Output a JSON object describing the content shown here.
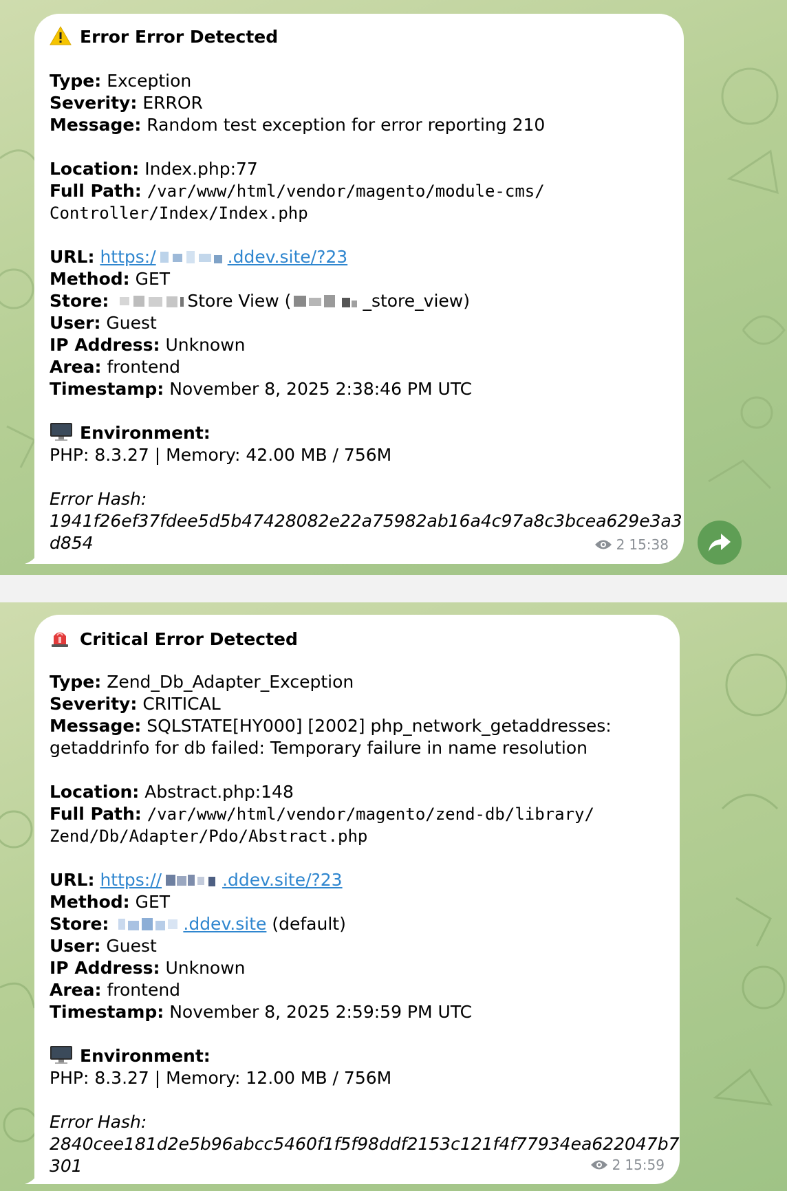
{
  "messages": [
    {
      "title": "Error Error Detected",
      "title_icon": "warning-icon",
      "type_label": "Type:",
      "type_value": "Exception",
      "severity_label": "Severity:",
      "severity_value": "ERROR",
      "message_label": "Message:",
      "message_value": "Random test exception for error reporting 210",
      "location_label": "Location:",
      "location_value": "Index.php:77",
      "full_path_label": "Full Path:",
      "full_path_line1": "/var/www/html/vendor/magento/module-cms/",
      "full_path_line2": "Controller/Index/Index.php",
      "url_label": "URL:",
      "url_prefix": "https:/",
      "url_suffix": ".ddev.site/?23",
      "method_label": "Method:",
      "method_value": "GET",
      "store_label": "Store:",
      "store_mid": "Store View (",
      "store_end": "_store_view)",
      "user_label": "User:",
      "user_value": "Guest",
      "ip_label": "IP Address:",
      "ip_value": "Unknown",
      "area_label": "Area:",
      "area_value": "frontend",
      "timestamp_label": "Timestamp:",
      "timestamp_value": "November 8, 2025 2:38:46 PM UTC",
      "env_label": "Environment:",
      "env_icon": "monitor-icon",
      "env_value": "PHP: 8.3.27 | Memory: 42.00 MB / 756M",
      "hash_label": "Error Hash:",
      "hash_line1": "1941f26ef37fdee5d5b47428082e22a75982ab16a4c97a8c3bcea629e3a3",
      "hash_line2": "d854",
      "views": "2",
      "time": "15:38"
    },
    {
      "title": "Critical Error Detected",
      "title_icon": "siren-icon",
      "type_label": "Type:",
      "type_value": "Zend_Db_Adapter_Exception",
      "severity_label": "Severity:",
      "severity_value": "CRITICAL",
      "message_label": "Message:",
      "message_line1": "SQLSTATE[HY000] [2002] php_network_getaddresses:",
      "message_line2": "getaddrinfo for db failed: Temporary failure in name resolution",
      "location_label": "Location:",
      "location_value": "Abstract.php:148",
      "full_path_label": "Full Path:",
      "full_path_line1": "/var/www/html/vendor/magento/zend-db/library/",
      "full_path_line2": "Zend/Db/Adapter/Pdo/Abstract.php",
      "url_label": "URL:",
      "url_prefix": "https://",
      "url_suffix": ".ddev.site/?23",
      "method_label": "Method:",
      "method_value": "GET",
      "store_label": "Store:",
      "store_link_suffix": ".ddev.site",
      "store_end": "(default)",
      "user_label": "User:",
      "user_value": "Guest",
      "ip_label": "IP Address:",
      "ip_value": "Unknown",
      "area_label": "Area:",
      "area_value": "frontend",
      "timestamp_label": "Timestamp:",
      "timestamp_value": "November 8, 2025 2:59:59 PM UTC",
      "env_label": "Environment:",
      "env_icon": "monitor-icon",
      "env_value": "PHP: 8.3.27 | Memory: 12.00 MB / 756M",
      "hash_label": "Error Hash:",
      "hash_line1": "2840cee181d2e5b96abcc5460f1f5f98ddf2153c121f4f77934ea622047b7",
      "hash_line2": "301",
      "views": "2",
      "time": "15:59"
    }
  ],
  "share_icon": "share-arrow-icon",
  "colors": {
    "link": "#2f86cf",
    "bubble": "#ffffff",
    "share_button": "#5f9e55",
    "meta_text": "#8a8f95"
  }
}
